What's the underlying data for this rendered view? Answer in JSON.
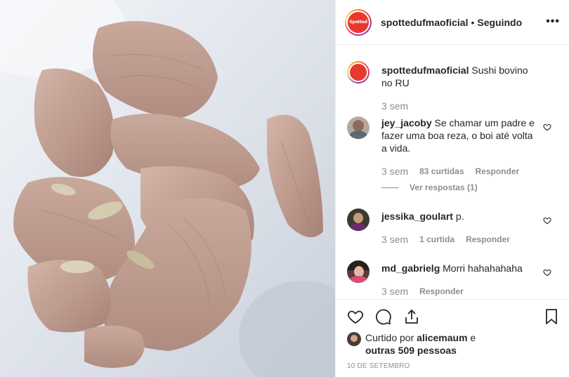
{
  "post": {
    "image_description_icon": "photo",
    "header": {
      "username": "spottedufmaoficial",
      "separator": "•",
      "follow_status": "Seguindo",
      "more_label": "•••"
    },
    "logo_text": "Spotted",
    "caption": {
      "username": "spottedufmaoficial",
      "text": "Sushi bovino no RU",
      "time": "3 sem"
    },
    "comments": [
      {
        "username": "jey_jacoby",
        "text": "Se chamar um padre e fazer uma boa reza, o boi até volta a vida.",
        "time": "3 sem",
        "likes": "83 curtidas",
        "reply": "Responder",
        "view_replies": "Ver respostas (1)"
      },
      {
        "username": "jessika_goulart",
        "text": "p.",
        "time": "3 sem",
        "likes": "1 curtida",
        "reply": "Responder"
      },
      {
        "username": "md_gabrielg",
        "text": "Morri hahahahaha",
        "time": "3 sem",
        "reply": "Responder"
      }
    ],
    "liked_by": {
      "prefix": "Curtido por",
      "user": "alicemaum",
      "conj": "e",
      "others": "outras 509 pessoas"
    },
    "date": "10 DE SETEMBRO",
    "colors": {
      "brand_red": "#e8392c",
      "text": "#262626",
      "muted": "#8e8e8e",
      "border": "#efefef"
    }
  }
}
